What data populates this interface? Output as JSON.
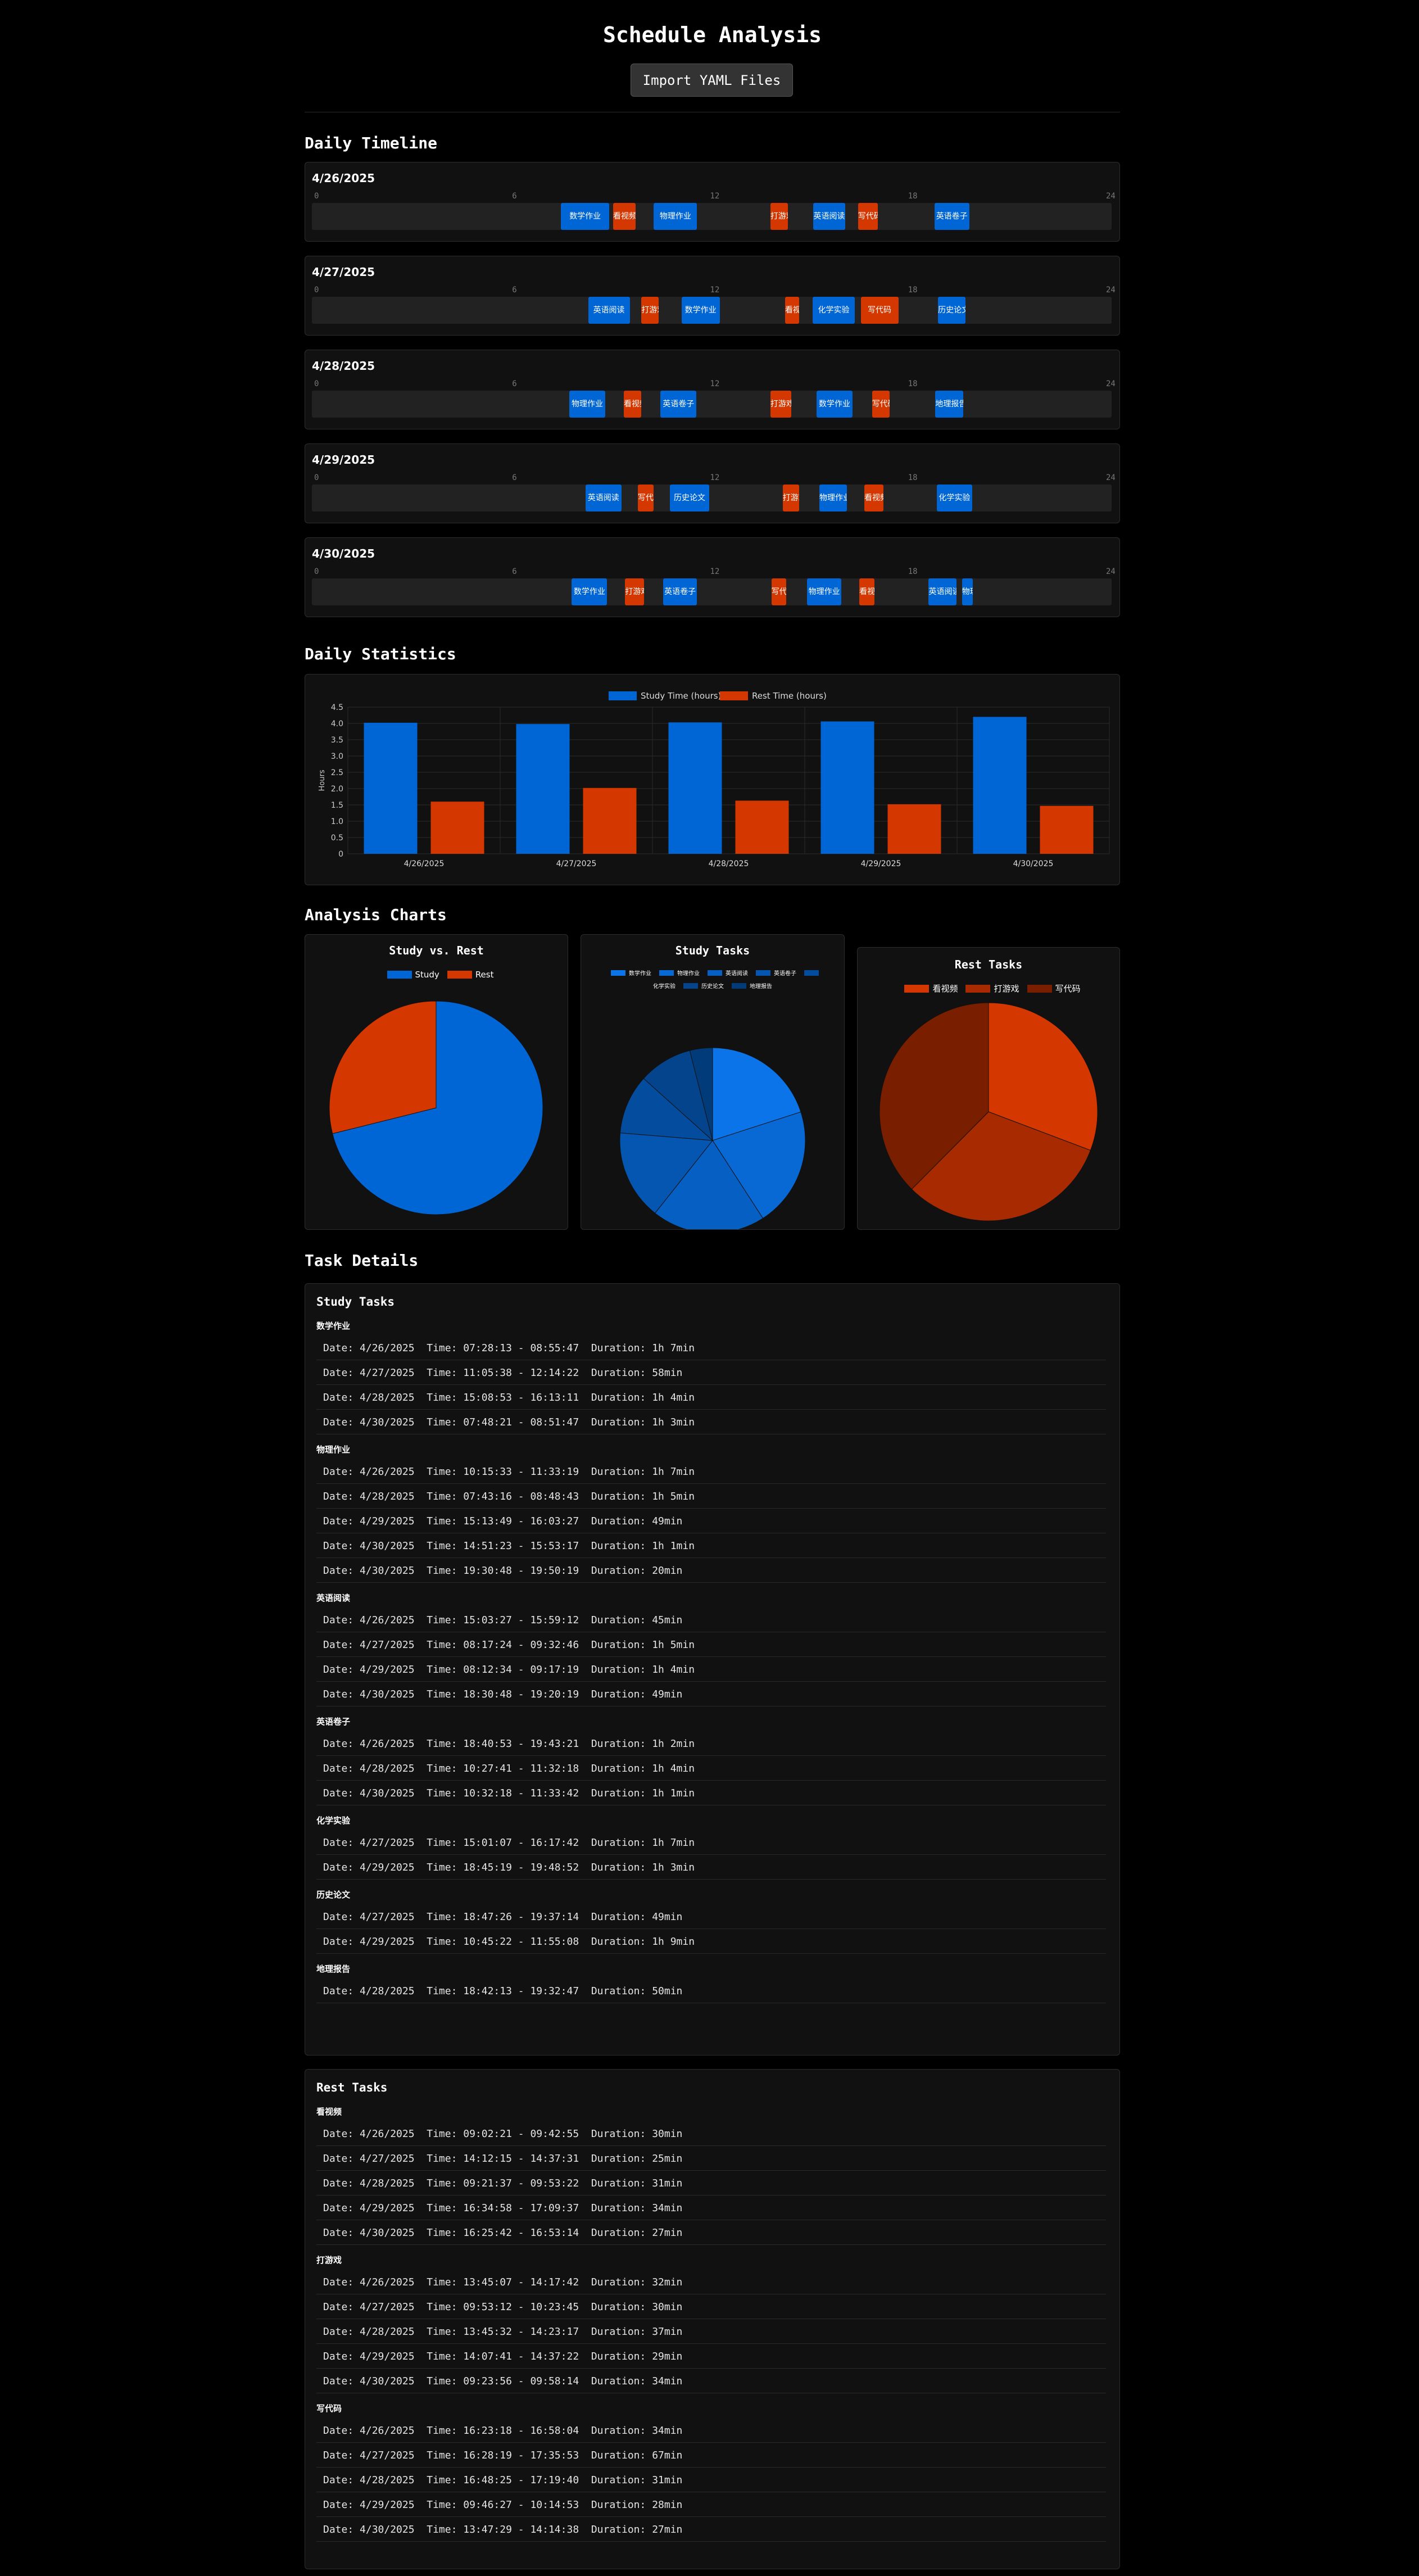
{
  "header": {
    "title": "Schedule Analysis",
    "import_label": "Import YAML Files"
  },
  "sections": {
    "timeline": "Daily Timeline",
    "statistics": "Daily Statistics",
    "analysis": "Analysis Charts",
    "details": "Task Details"
  },
  "timeline": {
    "ticks": [
      "0",
      "6",
      "12",
      "18",
      "24"
    ],
    "days": [
      {
        "date": "4/26/2025",
        "blocks": [
          {
            "label": "数学作业",
            "kind": "study",
            "start": 7.47,
            "end": 8.93
          },
          {
            "label": "看视频",
            "kind": "rest",
            "start": 9.04,
            "end": 9.71
          },
          {
            "label": "物理作业",
            "kind": "study",
            "start": 10.26,
            "end": 11.56
          },
          {
            "label": "打游戏",
            "kind": "rest",
            "start": 13.76,
            "end": 14.29
          },
          {
            "label": "英语阅读",
            "kind": "study",
            "start": 15.05,
            "end": 16.0
          },
          {
            "label": "写代码",
            "kind": "rest",
            "start": 16.39,
            "end": 16.98
          },
          {
            "label": "英语卷子",
            "kind": "study",
            "start": 18.68,
            "end": 19.73
          }
        ]
      },
      {
        "date": "4/27/2025",
        "blocks": [
          {
            "label": "英语阅读",
            "kind": "study",
            "start": 8.29,
            "end": 9.54
          },
          {
            "label": "打游戏",
            "kind": "rest",
            "start": 9.89,
            "end": 10.4
          },
          {
            "label": "数学作业",
            "kind": "study",
            "start": 11.09,
            "end": 12.24
          },
          {
            "label": "看视频",
            "kind": "rest",
            "start": 14.2,
            "end": 14.63
          },
          {
            "label": "化学实验",
            "kind": "study",
            "start": 15.02,
            "end": 16.3
          },
          {
            "label": "写代码",
            "kind": "rest",
            "start": 16.47,
            "end": 17.6
          },
          {
            "label": "历史论文",
            "kind": "study",
            "start": 18.79,
            "end": 19.62
          }
        ]
      },
      {
        "date": "4/28/2025",
        "blocks": [
          {
            "label": "物理作业",
            "kind": "study",
            "start": 7.72,
            "end": 8.81
          },
          {
            "label": "看视频",
            "kind": "rest",
            "start": 9.36,
            "end": 9.89
          },
          {
            "label": "英语卷子",
            "kind": "study",
            "start": 10.46,
            "end": 11.54
          },
          {
            "label": "打游戏",
            "kind": "rest",
            "start": 13.76,
            "end": 14.39
          },
          {
            "label": "数学作业",
            "kind": "study",
            "start": 15.15,
            "end": 16.22
          },
          {
            "label": "写代码",
            "kind": "rest",
            "start": 16.81,
            "end": 17.33
          },
          {
            "label": "地理报告",
            "kind": "study",
            "start": 18.71,
            "end": 19.55
          }
        ]
      },
      {
        "date": "4/29/2025",
        "blocks": [
          {
            "label": "英语阅读",
            "kind": "study",
            "start": 8.21,
            "end": 9.29
          },
          {
            "label": "写代码",
            "kind": "rest",
            "start": 9.78,
            "end": 10.25
          },
          {
            "label": "历史论文",
            "kind": "study",
            "start": 10.75,
            "end": 11.92
          },
          {
            "label": "打游戏",
            "kind": "rest",
            "start": 14.13,
            "end": 14.62
          },
          {
            "label": "物理作业",
            "kind": "study",
            "start": 15.23,
            "end": 16.06
          },
          {
            "label": "看视频",
            "kind": "rest",
            "start": 16.58,
            "end": 17.15
          },
          {
            "label": "化学实验",
            "kind": "study",
            "start": 18.76,
            "end": 19.81
          }
        ]
      },
      {
        "date": "4/30/2025",
        "blocks": [
          {
            "label": "数学作业",
            "kind": "study",
            "start": 7.8,
            "end": 8.86
          },
          {
            "label": "打游戏",
            "kind": "rest",
            "start": 9.4,
            "end": 9.97
          },
          {
            "label": "英语卷子",
            "kind": "study",
            "start": 10.54,
            "end": 11.56
          },
          {
            "label": "写代码",
            "kind": "rest",
            "start": 13.79,
            "end": 14.24
          },
          {
            "label": "物理作业",
            "kind": "study",
            "start": 14.86,
            "end": 15.89
          },
          {
            "label": "看视频",
            "kind": "rest",
            "start": 16.43,
            "end": 16.89
          },
          {
            "label": "英语阅读",
            "kind": "study",
            "start": 18.51,
            "end": 19.34
          },
          {
            "label": "物理作业",
            "kind": "study",
            "start": 19.51,
            "end": 19.84
          }
        ]
      }
    ]
  },
  "chart_data": [
    {
      "type": "bar",
      "categories": [
        "4/26/2025",
        "4/27/2025",
        "4/28/2025",
        "4/29/2025",
        "4/30/2025"
      ],
      "series": [
        {
          "name": "Study Time (hours)",
          "color": "#0066d6",
          "values": [
            4.02,
            3.98,
            4.03,
            4.06,
            4.2
          ]
        },
        {
          "name": "Rest Time (hours)",
          "color": "#d43800",
          "values": [
            1.6,
            2.02,
            1.63,
            1.52,
            1.47
          ]
        }
      ],
      "ylabel": "Hours",
      "ylim": [
        0,
        4.5
      ],
      "yticks": [
        "0",
        "0.5",
        "1.0",
        "1.5",
        "2.0",
        "2.5",
        "3.0",
        "3.5",
        "4.0",
        "4.5"
      ],
      "legend": "top",
      "grid": true
    },
    {
      "type": "pie",
      "title": "Study vs. Rest",
      "labels": [
        "Study",
        "Rest"
      ],
      "values": [
        20.29,
        8.24
      ],
      "colors": [
        "#0066d6",
        "#d43800"
      ]
    },
    {
      "type": "pie",
      "title": "Study Tasks",
      "labels": [
        "数学作业",
        "物理作业",
        "英语阅读",
        "英语卷子",
        "化学实验",
        "历史论文",
        "地理报告"
      ],
      "values": [
        4.2,
        4.37,
        4.15,
        3.28,
        2.17,
        1.97,
        0.83
      ],
      "colors": [
        "#0a74e8",
        "#0868d4",
        "#065fc2",
        "#0556b0",
        "#044d9e",
        "#03448c",
        "#023b7a"
      ]
    },
    {
      "type": "pie",
      "title": "Rest Tasks",
      "labels": [
        "看视频",
        "打游戏",
        "写代码"
      ],
      "values": [
        2.62,
        2.7,
        3.2
      ],
      "colors": [
        "#d43800",
        "#a82a00",
        "#7a1e00"
      ]
    }
  ],
  "details": {
    "study_title": "Study Tasks",
    "rest_title": "Rest Tasks",
    "study": [
      {
        "name": "数学作业",
        "rows": [
          "Date: 4/26/2025  Time: 07:28:13 - 08:55:47  Duration: 1h 7min",
          "Date: 4/27/2025  Time: 11:05:38 - 12:14:22  Duration: 58min",
          "Date: 4/28/2025  Time: 15:08:53 - 16:13:11  Duration: 1h 4min",
          "Date: 4/30/2025  Time: 07:48:21 - 08:51:47  Duration: 1h 3min"
        ]
      },
      {
        "name": "物理作业",
        "rows": [
          "Date: 4/26/2025  Time: 10:15:33 - 11:33:19  Duration: 1h 7min",
          "Date: 4/28/2025  Time: 07:43:16 - 08:48:43  Duration: 1h 5min",
          "Date: 4/29/2025  Time: 15:13:49 - 16:03:27  Duration: 49min",
          "Date: 4/30/2025  Time: 14:51:23 - 15:53:17  Duration: 1h 1min",
          "Date: 4/30/2025  Time: 19:30:48 - 19:50:19  Duration: 20min"
        ]
      },
      {
        "name": "英语阅读",
        "rows": [
          "Date: 4/26/2025  Time: 15:03:27 - 15:59:12  Duration: 45min",
          "Date: 4/27/2025  Time: 08:17:24 - 09:32:46  Duration: 1h 5min",
          "Date: 4/29/2025  Time: 08:12:34 - 09:17:19  Duration: 1h 4min",
          "Date: 4/30/2025  Time: 18:30:48 - 19:20:19  Duration: 49min"
        ]
      },
      {
        "name": "英语卷子",
        "rows": [
          "Date: 4/26/2025  Time: 18:40:53 - 19:43:21  Duration: 1h 2min",
          "Date: 4/28/2025  Time: 10:27:41 - 11:32:18  Duration: 1h 4min",
          "Date: 4/30/2025  Time: 10:32:18 - 11:33:42  Duration: 1h 1min"
        ]
      },
      {
        "name": "化学实验",
        "rows": [
          "Date: 4/27/2025  Time: 15:01:07 - 16:17:42  Duration: 1h 7min",
          "Date: 4/29/2025  Time: 18:45:19 - 19:48:52  Duration: 1h 3min"
        ]
      },
      {
        "name": "历史论文",
        "rows": [
          "Date: 4/27/2025  Time: 18:47:26 - 19:37:14  Duration: 49min",
          "Date: 4/29/2025  Time: 10:45:22 - 11:55:08  Duration: 1h 9min"
        ]
      },
      {
        "name": "地理报告",
        "rows": [
          "Date: 4/28/2025  Time: 18:42:13 - 19:32:47  Duration: 50min"
        ]
      }
    ],
    "rest": [
      {
        "name": "看视频",
        "rows": [
          "Date: 4/26/2025  Time: 09:02:21 - 09:42:55  Duration: 30min",
          "Date: 4/27/2025  Time: 14:12:15 - 14:37:31  Duration: 25min",
          "Date: 4/28/2025  Time: 09:21:37 - 09:53:22  Duration: 31min",
          "Date: 4/29/2025  Time: 16:34:58 - 17:09:37  Duration: 34min",
          "Date: 4/30/2025  Time: 16:25:42 - 16:53:14  Duration: 27min"
        ]
      },
      {
        "name": "打游戏",
        "rows": [
          "Date: 4/26/2025  Time: 13:45:07 - 14:17:42  Duration: 32min",
          "Date: 4/27/2025  Time: 09:53:12 - 10:23:45  Duration: 30min",
          "Date: 4/28/2025  Time: 13:45:32 - 14:23:17  Duration: 37min",
          "Date: 4/29/2025  Time: 14:07:41 - 14:37:22  Duration: 29min",
          "Date: 4/30/2025  Time: 09:23:56 - 09:58:14  Duration: 34min"
        ]
      },
      {
        "name": "写代码",
        "rows": [
          "Date: 4/26/2025  Time: 16:23:18 - 16:58:04  Duration: 34min",
          "Date: 4/27/2025  Time: 16:28:19 - 17:35:53  Duration: 67min",
          "Date: 4/28/2025  Time: 16:48:25 - 17:19:40  Duration: 31min",
          "Date: 4/29/2025  Time: 09:46:27 - 10:14:53  Duration: 28min",
          "Date: 4/30/2025  Time: 13:47:29 - 14:14:38  Duration: 27min"
        ]
      }
    ]
  }
}
